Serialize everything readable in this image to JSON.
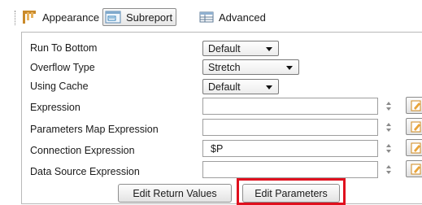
{
  "toolbar": {
    "tabs": [
      {
        "label": "Appearance",
        "icon": "appearance-icon"
      },
      {
        "label": "Subreport",
        "icon": "subreport-icon",
        "selected": true
      },
      {
        "label": "Advanced",
        "icon": "advanced-table-icon"
      }
    ]
  },
  "properties": {
    "run_to_bottom": {
      "label": "Run To Bottom",
      "value": "Default"
    },
    "overflow_type": {
      "label": "Overflow Type",
      "value": "Stretch"
    },
    "using_cache": {
      "label": "Using Cache",
      "value": "Default"
    },
    "expression": {
      "label": "Expression",
      "value": ""
    },
    "parameters_map_expression": {
      "label": "Parameters Map Expression",
      "value": ""
    },
    "connection_expression": {
      "label": "Connection Expression",
      "value": "$P"
    },
    "data_source_expression": {
      "label": "Data Source Expression",
      "value": ""
    }
  },
  "buttons": {
    "edit_return_values": "Edit Return Values",
    "edit_parameters": "Edit Parameters"
  },
  "colors": {
    "highlight": "#e0101e",
    "panel_border": "#b9b9b9"
  }
}
